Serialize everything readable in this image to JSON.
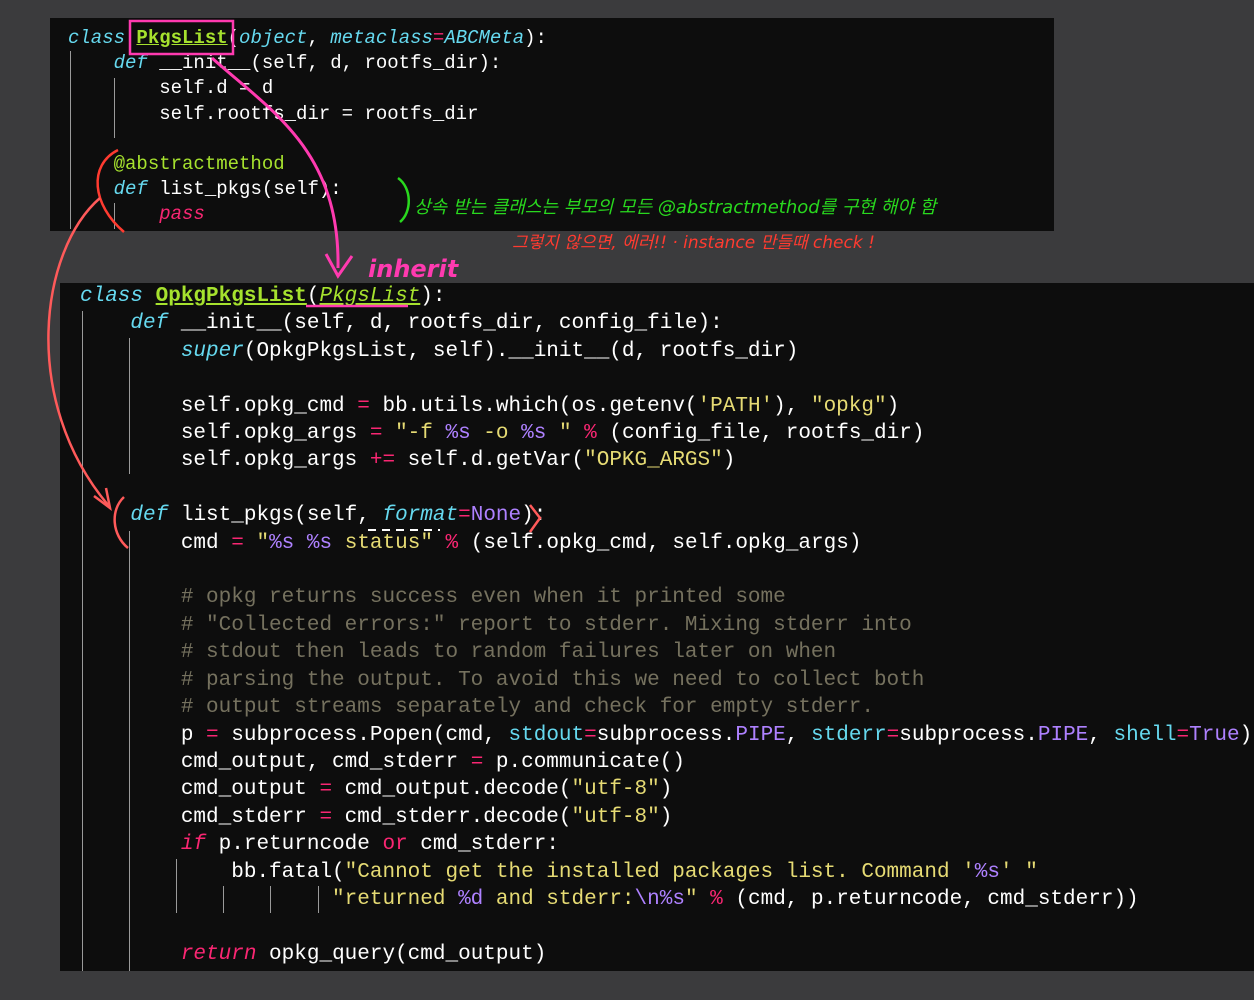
{
  "top_code": {
    "l1": {
      "kw": "class",
      "name": "PkgsList",
      "open": "(",
      "a1": "object",
      "sep": ", ",
      "kwarg": "metaclass",
      "eq": "=",
      "val": "ABCMeta",
      "close": "):"
    },
    "l2": {
      "kw": "def",
      "rest": " __init__(self, d, rootfs_dir):"
    },
    "l3": {
      "text": "self.d = d"
    },
    "l4": {
      "text": "self.rootfs_dir = rootfs_dir"
    },
    "l5": {
      "text": "@abstractmethod"
    },
    "l6": {
      "kw": "def",
      "rest": " list_pkgs(self):"
    },
    "l7": {
      "text": "pass"
    }
  },
  "bottom_code": {
    "l1": {
      "kw": "class",
      "name": "OpkgPkgsList",
      "open": "(",
      "base": "PkgsList",
      "close": "):"
    },
    "l2": {
      "kw": "def",
      "rest": " __init__(self, d, rootfs_dir, config_file):"
    },
    "l3": {
      "super": "super",
      "rest": "(OpkgPkgsList, self).__init__(d, rootfs_dir)"
    },
    "l4a": "self.opkg_cmd ",
    "l4op": "=",
    "l4b": " bb.utils.which(os.getenv(",
    "l4s1": "'PATH'",
    "l4c": "), ",
    "l4s2": "\"opkg\"",
    "l4d": ")",
    "l5a": "self.opkg_args ",
    "l5op": "=",
    "l5s1": " \"-f ",
    "l5f1": "%s",
    "l5s2": " -o ",
    "l5f2": "%s",
    "l5s3": " \"",
    "l5op2": " %",
    "l5b": " (config_file, rootfs_dir)",
    "l6a": "self.opkg_args ",
    "l6op": "+=",
    "l6b": " self.d.getVar(",
    "l6s": "\"OPKG_ARGS\"",
    "l6c": ")",
    "l7": {
      "kw": "def",
      "name": " list_pkgs(self, ",
      "kwarg": "format",
      "eq": "=",
      "val": "None",
      "close": "):"
    },
    "l8a": "cmd ",
    "l8op": "=",
    "l8s1": " \"",
    "l8f1": "%s",
    "l8s2": " ",
    "l8f2": "%s",
    "l8s3": " status\"",
    "l8op2": " %",
    "l8b": " (self.opkg_cmd, self.opkg_args)",
    "c1": "# opkg returns success even when it printed some",
    "c2": "# \"Collected errors:\" report to stderr. Mixing stderr into",
    "c3": "# stdout then leads to random failures later on when",
    "c4": "# parsing the output. To avoid this we need to collect both",
    "c5": "# output streams separately and check for empty stderr.",
    "l9a": "p ",
    "l9op": "=",
    "l9b": " subprocess.Popen(cmd, ",
    "l9k1": "stdout",
    "l9op2": "=",
    "l9c": "subprocess.",
    "l9p1": "PIPE",
    "l9d": ", ",
    "l9k2": "stderr",
    "l9op3": "=",
    "l9e": "subprocess.",
    "l9p2": "PIPE",
    "l9f": ", ",
    "l9k3": "shell",
    "l9op4": "=",
    "l9v": "True",
    "l9g": ")",
    "l10a": "cmd_output, cmd_stderr ",
    "l10op": "=",
    "l10b": " p.communicate()",
    "l11a": "cmd_output ",
    "l11op": "=",
    "l11b": " cmd_output.decode(",
    "l11s": "\"utf-8\"",
    "l11c": ")",
    "l12a": "cmd_stderr ",
    "l12op": "=",
    "l12b": " cmd_stderr.decode(",
    "l12s": "\"utf-8\"",
    "l12c": ")",
    "l13kw": "if",
    "l13a": " p.returncode ",
    "l13or": "or",
    "l13b": " cmd_stderr:",
    "l14a": "bb.fatal(",
    "l14s1": "\"Cannot get the installed packages list. Command '",
    "l14f": "%s",
    "l14s2": "' \"",
    "l15s1": "\"returned ",
    "l15f1": "%d",
    "l15s2": " and stderr:",
    "l15f2": "\\n%s",
    "l15s3": "\"",
    "l15op": " %",
    "l15b": " (cmd, p.returncode, cmd_stderr))",
    "l16kw": "return",
    "l16b": " opkg_query(cmd_output)"
  },
  "annotations": {
    "inherit": "inherit",
    "note_line1": "상속 받는 클래스는  부모의 모든  @abstractmethod를 구현 해야 함",
    "note_line2": "그렇지 않으면, 에러!! · instance 만들때 check !"
  },
  "colors": {
    "annotation_pink": "#ff3ab0",
    "annotation_green": "#29d81e",
    "annotation_red": "#ff3b30",
    "annotation_coral": "#ff5a5a"
  }
}
